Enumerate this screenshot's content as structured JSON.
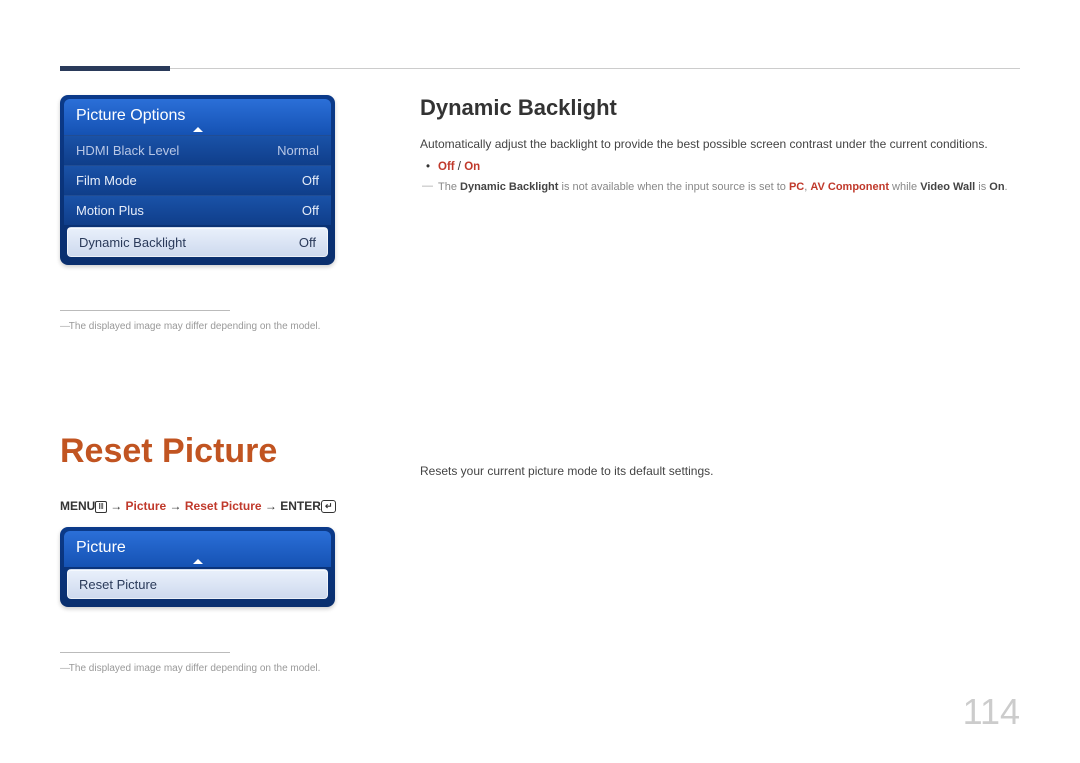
{
  "page_number": "114",
  "menu1": {
    "title": "Picture Options",
    "rows": [
      {
        "label": "HDMI Black Level",
        "value": "Normal",
        "dim": true
      },
      {
        "label": "Film Mode",
        "value": "Off"
      },
      {
        "label": "Motion Plus",
        "value": "Off"
      },
      {
        "label": "Dynamic Backlight",
        "value": "Off",
        "selected": true
      }
    ]
  },
  "footnote1": "The displayed image may differ depending on the model.",
  "right1": {
    "heading": "Dynamic Backlight",
    "desc": "Automatically adjust the backlight to provide the best possible screen contrast under the current conditions.",
    "bullet_off": "Off",
    "bullet_sep": " / ",
    "bullet_on": "On",
    "note_pre": "The ",
    "note_b1": "Dynamic Backlight",
    "note_mid1": " is not available when the input source is set to ",
    "note_pc": "PC",
    "note_mid2": ", ",
    "note_av": "AV Component",
    "note_mid3": " while ",
    "note_vw": "Video Wall",
    "note_mid4": " is ",
    "note_on": "On",
    "note_end": "."
  },
  "reset": {
    "heading": "Reset Picture",
    "crumb_menu": "MENU",
    "crumb_arrow": " → ",
    "crumb_picture": "Picture",
    "crumb_reset": "Reset Picture",
    "crumb_enter": "ENTER",
    "menu_title": "Picture",
    "menu_item": "Reset Picture",
    "footnote": "The displayed image may differ depending on the model.",
    "right_text": "Resets your current picture mode to its default settings."
  }
}
